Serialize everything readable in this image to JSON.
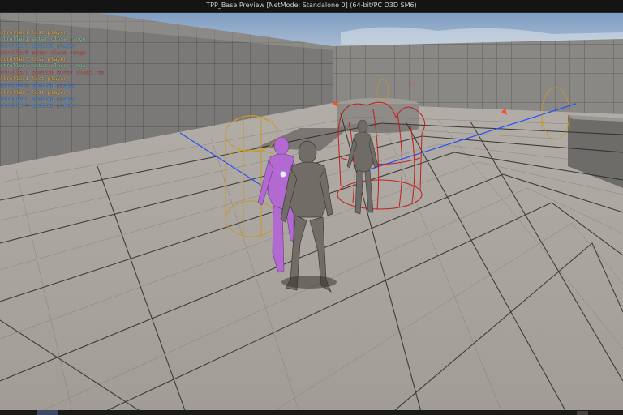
{
  "window": {
    "title": "TPP_Base Preview [NetMode: Standalone 0]  (64-bit/PC D3D SM6)"
  },
  "debug_log": {
    "lines": [
      {
        "text": "ntroller1 lost player",
        "color": "#e8b64a"
      },
      {
        "text": "ntroller1 enter close range",
        "color": "#8fd4a0"
      },
      {
        "text": "ntroller1 spotted player",
        "color": "#5aa3ff"
      },
      {
        "text": "ntroller0 enter close range",
        "color": "#e26a6a"
      },
      {
        "text": "ntroller0 lost player",
        "color": "#e8b64a"
      },
      {
        "text": "ntroller0 enter close range",
        "color": "#8fd4a0"
      },
      {
        "text": "ntroller1 spotted enter close range",
        "color": "#e26a6a"
      },
      {
        "text": "ntroller1 lost player",
        "color": "#e8b64a"
      },
      {
        "text": "ntroller0 spotted player",
        "color": "#5aa3ff"
      },
      {
        "text": "ntroller0 lost player",
        "color": "#e8b64a"
      },
      {
        "text": "ntroller1 spotted player",
        "color": "#5aa3ff"
      },
      {
        "text": "ntroller0 spotted player",
        "color": "#5aa3ff"
      }
    ]
  },
  "scene": {
    "colors": {
      "sky": "#8fa9c9",
      "floor": "#a9a39d",
      "wall": "#858380",
      "grid_line": "#2b2b2b",
      "mannequin": "#6f6b66",
      "mannequin_selected": "#b26ad2",
      "sight_line": "#2450ff",
      "capsule_perception": "#c49a2a",
      "capsule_close_range": "#c21f1f",
      "marker": "#ff4a2a"
    }
  }
}
